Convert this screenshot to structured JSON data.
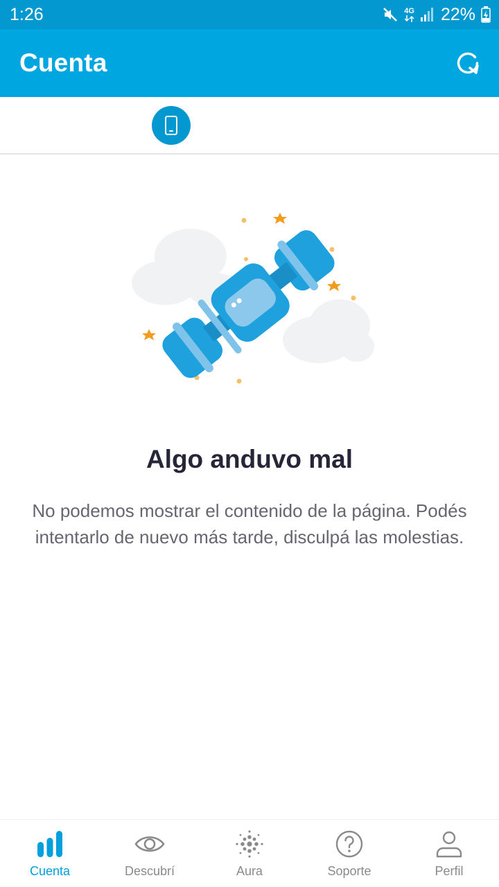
{
  "status_bar": {
    "time": "1:26",
    "network": "4G",
    "battery": "22%",
    "icons": [
      "mute-icon",
      "signal-icon",
      "battery-charging-icon"
    ]
  },
  "app_bar": {
    "title": "Cuenta",
    "refresh_icon": "refresh-icon"
  },
  "line_tabs": {
    "items": [
      {
        "icon": "phone-icon",
        "selected": true
      }
    ]
  },
  "error": {
    "title": "Algo anduvo mal",
    "message": "No podemos mostrar el contenido de la página. Podés intentarlo de nuevo más tarde, disculpá las molestias.",
    "illustration": "satellite-illustration"
  },
  "bottom_nav": {
    "items": [
      {
        "label": "Cuenta",
        "icon": "bar-chart-icon",
        "active": true
      },
      {
        "label": "Descubrí",
        "icon": "eye-icon",
        "active": false
      },
      {
        "label": "Aura",
        "icon": "dots-cluster-icon",
        "active": false
      },
      {
        "label": "Soporte",
        "icon": "question-circle-icon",
        "active": false
      },
      {
        "label": "Perfil",
        "icon": "user-icon",
        "active": false
      }
    ]
  },
  "colors": {
    "status_bar": "#0399d0",
    "app_bar": "#00a6e0",
    "accent": "#00a0dc",
    "title_text": "#262638",
    "body_text": "#666670",
    "inactive_nav": "#8a8a8a"
  }
}
